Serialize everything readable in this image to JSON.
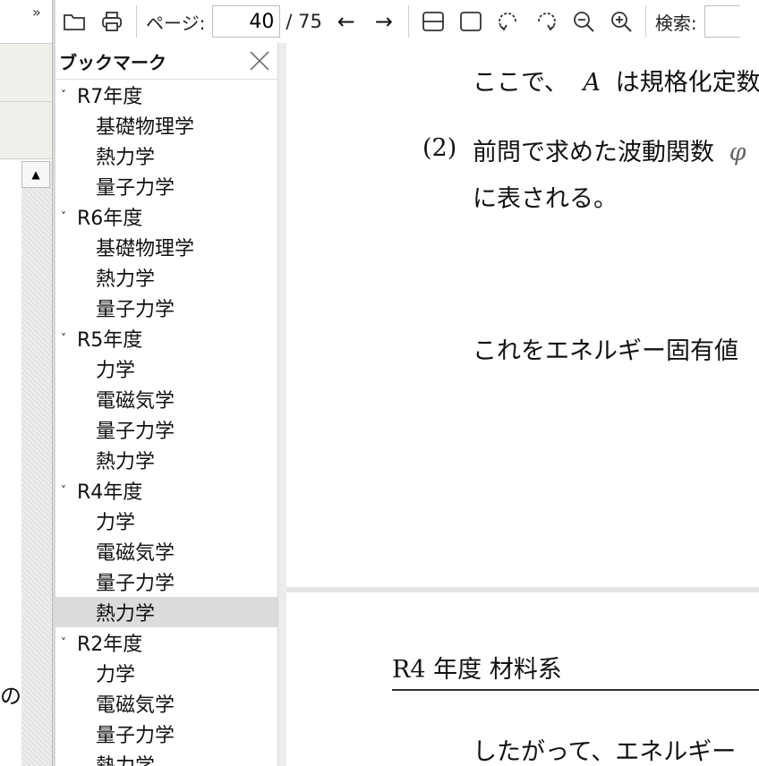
{
  "left_strip": {
    "chevron": "»",
    "fragment": "の",
    "scroll_up": "▲"
  },
  "toolbar": {
    "page_label": "ページ:",
    "page_value": "40",
    "page_total": "/ 75",
    "prev_arrow": "←",
    "next_arrow": "→",
    "search_label": "検索:",
    "icons": [
      "folder-icon",
      "printer-icon",
      "fit-width-icon",
      "fit-page-icon",
      "rotate-left-icon",
      "rotate-right-icon",
      "zoom-out-icon",
      "zoom-in-icon"
    ]
  },
  "bookmarks": {
    "title": "ブックマーク",
    "groups": [
      {
        "label": "R7年度",
        "children": [
          "基礎物理学",
          "熱力学",
          "量子力学"
        ]
      },
      {
        "label": "R6年度",
        "children": [
          "基礎物理学",
          "熱力学",
          "量子力学"
        ]
      },
      {
        "label": "R5年度",
        "children": [
          "力学",
          "電磁気学",
          "量子力学",
          "熱力学"
        ]
      },
      {
        "label": "R4年度",
        "children": [
          "力学",
          "電磁気学",
          "量子力学",
          "熱力学"
        ]
      },
      {
        "label": "R2年度",
        "children": [
          "力学",
          "電磁気学",
          "量子力学",
          "熱力学"
        ]
      }
    ],
    "selected": "R4年度/熱力学"
  },
  "document": {
    "line1_a": "ここで、",
    "line1_var": "A",
    "line1_b": "は規格化定数",
    "q2_num": "(2)",
    "q2_a": "前問で求めた波動関数",
    "q2_var": "φ",
    "q2_line2": "に表される。",
    "line3": "これをエネルギー固有値",
    "section_num": "R4",
    "section_rest": "年度 材料系",
    "line4": "したがって、エネルギー"
  }
}
